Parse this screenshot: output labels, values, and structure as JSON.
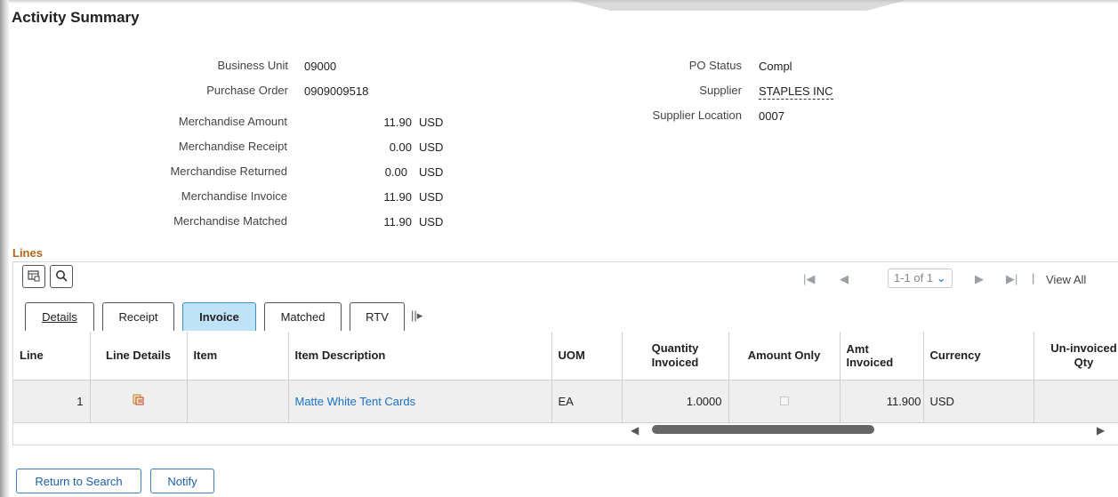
{
  "page": {
    "title": "Activity Summary"
  },
  "summary": {
    "business_unit": {
      "label": "Business Unit",
      "value": "09000"
    },
    "purchase_order": {
      "label": "Purchase Order",
      "value": "0909009518"
    },
    "po_status": {
      "label": "PO Status",
      "value": "Compl"
    },
    "supplier": {
      "label": "Supplier",
      "value": "STAPLES INC"
    },
    "supplier_location": {
      "label": "Supplier Location",
      "value": "0007"
    },
    "amounts": [
      {
        "label": "Merchandise Amount",
        "value": "11.90",
        "currency": "USD"
      },
      {
        "label": "Merchandise Receipt",
        "value": "0.00",
        "currency": "USD"
      },
      {
        "label": "Merchandise Returned",
        "value": "0.00",
        "currency": "USD"
      },
      {
        "label": "Merchandise Invoice",
        "value": "11.90",
        "currency": "USD"
      },
      {
        "label": "Merchandise Matched",
        "value": "11.90",
        "currency": "USD"
      }
    ]
  },
  "lines": {
    "title": "Lines",
    "toolbar": {
      "personalize_icon": "grid-settings-icon",
      "find_icon": "search-icon"
    },
    "pager": {
      "range": "1-1 of 1",
      "view_all": "View All"
    },
    "tabs": [
      {
        "label": "Details",
        "active": false
      },
      {
        "label": "Receipt",
        "active": false
      },
      {
        "label": "Invoice",
        "active": true
      },
      {
        "label": "Matched",
        "active": false
      },
      {
        "label": "RTV",
        "active": false
      }
    ],
    "columns": {
      "line": "Line",
      "line_details": "Line Details",
      "item": "Item",
      "item_description": "Item Description",
      "uom": "UOM",
      "quantity_invoiced": "Quantity Invoiced",
      "amount_only": "Amount Only",
      "amt_invoiced": "Amt Invoiced",
      "currency": "Currency",
      "uninvoiced_qty": "Un-invoiced Qty"
    },
    "rows": [
      {
        "line": "1",
        "line_details_icon": "line-details-icon",
        "item": "",
        "item_description": "Matte White Tent Cards",
        "uom": "EA",
        "quantity_invoiced": "1.0000",
        "amount_only": false,
        "amt_invoiced": "11.900",
        "currency": "USD",
        "uninvoiced_qty": ""
      }
    ]
  },
  "buttons": {
    "return_to_search": "Return to Search",
    "notify": "Notify"
  },
  "colors": {
    "accent": "#1a73c8",
    "section_title": "#b5651d",
    "active_tab": "#bfe2f7"
  }
}
